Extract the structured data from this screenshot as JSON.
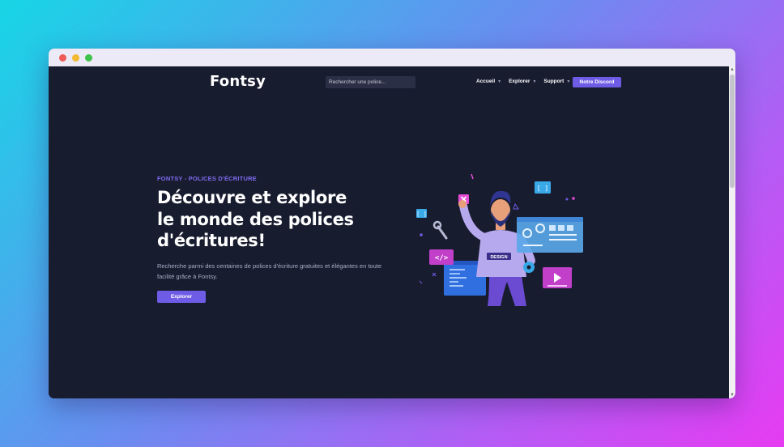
{
  "header": {
    "logo": "Fontsy",
    "search_placeholder": "Rechercher une police...",
    "nav": [
      {
        "label": "Accueil"
      },
      {
        "label": "Explorer"
      },
      {
        "label": "Support"
      }
    ],
    "discord_label": "Notre Discord"
  },
  "hero": {
    "eyebrow": "FONTSY - POLICES D'ÉCRITURE",
    "headline": "Découvre et explore le monde des polices d'écritures!",
    "description": "Recherche parmi des centaines de polices d'écriture gratuites et élégantes en toute facilité grâce à Fontsy.",
    "cta_label": "Explorer",
    "illustration_badge": "DESIGN",
    "illustration_code_tag": "</>",
    "illustration_bracket": "[ ]",
    "illustration_icons": [
      "code-icon",
      "play-icon",
      "gear-icon",
      "close-icon",
      "wrench-icon"
    ]
  },
  "colors": {
    "page_bg": "#181c2f",
    "accent": "#6e5ce6",
    "eyebrow": "#7b6cf0",
    "text_muted": "#a9aec6"
  }
}
